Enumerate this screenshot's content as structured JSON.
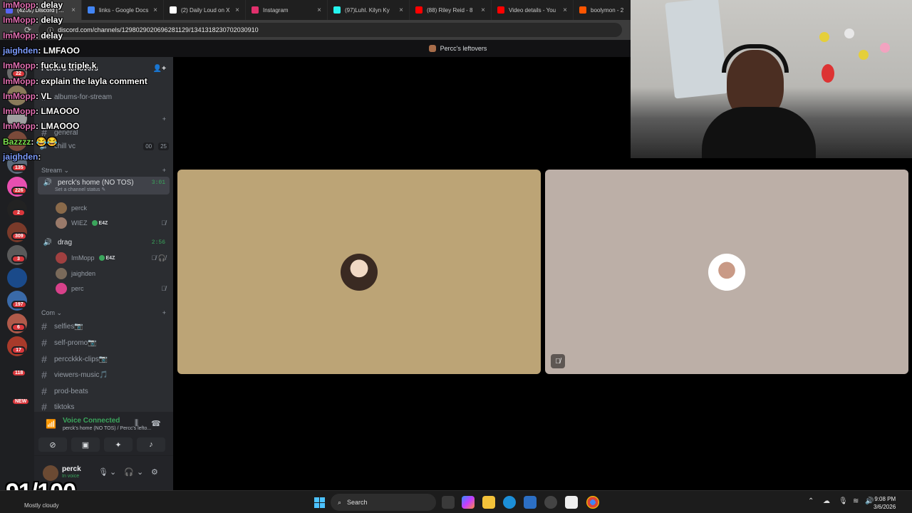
{
  "browser": {
    "tabs": [
      {
        "title": "(4269) Discord | ...",
        "color": "#5865f2"
      },
      {
        "title": "links - Google Docs",
        "color": "#4285f4"
      },
      {
        "title": "(2) Daily Loud on X",
        "color": "#ffffff"
      },
      {
        "title": "Instagram",
        "color": "#e1306c"
      },
      {
        "title": "(97)Luhl. Kilyn Ky",
        "color": "#25f4ee"
      },
      {
        "title": "(88) Riley Reid - 8",
        "color": "#ff0000"
      },
      {
        "title": "Video details - You",
        "color": "#ff0000"
      },
      {
        "title": "boolymon - 2",
        "color": "#ff5500"
      }
    ],
    "url": "discord.com/channels/1298029020696281129/1341318230702030910"
  },
  "discord": {
    "server_title": "Percc's leftovers",
    "server_name": "Percc's leftovers",
    "rail_badges": [
      "22",
      "135",
      "226",
      "2",
      "309",
      "3",
      "197",
      "6",
      "17",
      "118",
      "NEW"
    ],
    "channels_top": [
      {
        "name": "albums-for-stream"
      },
      {
        "name": "general"
      }
    ],
    "chill_vc": {
      "name": "chill vc",
      "count_a": "00",
      "count_b": "25"
    },
    "category_stream": "Stream",
    "vc1": {
      "name": "perck's home (NO TOS)",
      "time": "3:01",
      "status": "Set a channel status"
    },
    "vc1_users": [
      {
        "name": "perck",
        "tag": ""
      },
      {
        "name": "WIEZ",
        "tag": "E4Z"
      }
    ],
    "vc2": {
      "name": "drag",
      "time": "2:56"
    },
    "vc2_users": [
      {
        "name": "ImMopp",
        "tag": "E4Z"
      },
      {
        "name": "jaighden",
        "tag": ""
      },
      {
        "name": "perc",
        "tag": ""
      }
    ],
    "category_com": "Com",
    "channels_com": [
      {
        "name": "selfies📷"
      },
      {
        "name": "self-promo📷"
      },
      {
        "name": "percckkk-clips📷"
      },
      {
        "name": "viewers-music🎵"
      },
      {
        "name": "prod-beats"
      },
      {
        "name": "tiktoks"
      }
    ],
    "voice": {
      "connected": "Voice Connected",
      "location": "perck's home (NO TOS) / Percc's lefto..."
    },
    "user": {
      "name": "perck",
      "status": "In voice"
    }
  },
  "chat": [
    {
      "user": "ImMopp",
      "text": "delay",
      "color": "pink"
    },
    {
      "user": "ImMopp",
      "text": "delay",
      "color": "pink"
    },
    {
      "user": "ImMopp",
      "text": "delay",
      "color": "pink"
    },
    {
      "user": "jaighden",
      "text": "LMFAOO",
      "color": "blue"
    },
    {
      "user": "ImMopp",
      "text": "fuck u triple k",
      "color": "pink"
    },
    {
      "user": "ImMopp",
      "text": "explain the layla comment",
      "color": "pink"
    },
    {
      "user": "ImMopp",
      "text": "VL",
      "color": "pink"
    },
    {
      "user": "ImMopp",
      "text": "LMAOOO",
      "color": "pink"
    },
    {
      "user": "ImMopp",
      "text": "LMAOOO",
      "color": "pink"
    },
    {
      "user": "Bazzzz",
      "text": "😂😂",
      "color": "green"
    },
    {
      "user": "jaighden",
      "text": "",
      "color": "blue"
    }
  ],
  "overlay_score": "91/100",
  "taskbar": {
    "weather": "Mostly cloudy",
    "search": "Search",
    "time": "9:08 PM",
    "date": "3/6/2026"
  }
}
